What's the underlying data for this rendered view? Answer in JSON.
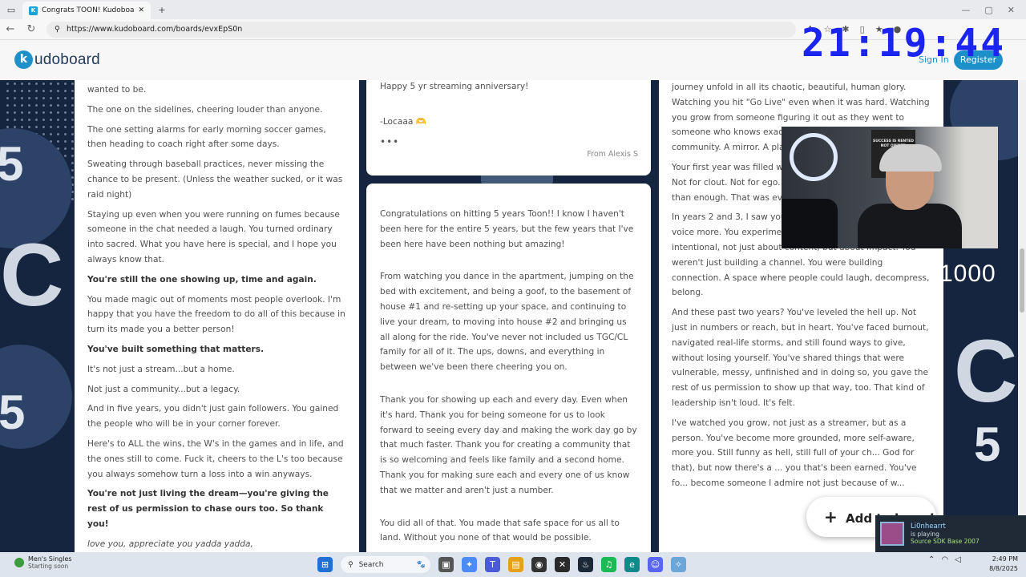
{
  "browser": {
    "tab_title": "Congrats TOON! Kudoboard | Kudoboard",
    "url": "https://www.kudoboard.com/boards/evxEpS0n"
  },
  "site": {
    "logo_letter": "k",
    "logo_text": "udoboard",
    "sign_in": "Sign In",
    "register": "Register"
  },
  "overlay": {
    "clock": "21:19:44",
    "counter": "1000",
    "poster_text": "SUCCESS IS RENTED NOT OWNED"
  },
  "col1": {
    "paragraphs": [
      {
        "text": "wanted to be.",
        "style": "normal"
      },
      {
        "text": "The one on the sidelines, cheering louder than anyone.",
        "style": "normal"
      },
      {
        "text": "The one setting alarms for early morning soccer games, then heading to coach right after some days.",
        "style": "normal"
      },
      {
        "text": "Sweating through baseball practices, never missing the chance to be present. (Unless the weather sucked, or it was raid night)",
        "style": "normal"
      },
      {
        "text": "Staying up even when you were running on fumes because someone in the chat needed a laugh. You turned ordinary into sacred. What you have here is special, and I hope you always know that.",
        "style": "normal"
      },
      {
        "text": "You're still the one showing up, time and again.",
        "style": "bold"
      },
      {
        "text": "You made magic out of moments most people overlook. I'm happy that you have the freedom to do all of this because in turn its made you a better person!",
        "style": "normal"
      },
      {
        "text": "You've built something that matters.",
        "style": "bold"
      },
      {
        "text": "It's not just a stream...but a home.",
        "style": "normal"
      },
      {
        "text": "Not just a community...but a legacy.",
        "style": "normal"
      },
      {
        "text": "And in five years, you didn't just gain followers. You gained the people who will be in your corner forever.",
        "style": "normal"
      },
      {
        "text": "Here's to ALL the wins, the W's in the games and in life, and the ones still to come. Fuck it, cheers to the L's too because you always somehow turn a loss into a win anyways.",
        "style": "normal"
      },
      {
        "text": "You're not just living the dream—you're giving the rest of us permission to chase ours too. So thank you!",
        "style": "bold"
      },
      {
        "text": "love you, appreciate you yadda yadda, blahblahblah...always.",
        "style": "italic"
      }
    ]
  },
  "col2a": {
    "line1": "Happy 5 yr streaming anniversary!",
    "line2": "-Locaaa 🫶",
    "more": "•••",
    "from": "From Alexis S"
  },
  "col2b": {
    "paragraphs": [
      "Congratulations on hitting 5 years Toon!! I know I haven't been here for the entire 5 years, but the few years that I've been here have been nothing but amazing!",
      "From watching you dance in the apartment, jumping on the bed with excitement, and being a goof, to the basement of house #1 and re-setting up your space, and continuing to live your dream, to moving into house #2 and bringing us all along for the ride. You've never not included us TGC/CL family for all of it. The ups, downs, and everything in between we've been there cheering you on.",
      "Thank you for showing up each and every day. Even when it's hard. Thank you for being someone for us to look forward to seeing every day and making the work day go by that much faster. Thank you for creating a community that is so welcoming and feels like family and a second home. Thank you for making sure each and every one of us know that we matter and aren't just a number.",
      "You did all of that. You made that safe space for us all to land. Without you none of that would be possible."
    ]
  },
  "col3": {
    "paragraphs": [
      "journey unfold in all its chaotic, beautiful, human glory. Watching you hit \"Go Live\" even when it was hard. Watching you grow from someone figuring it out as they went to someone who knows exac... The space you've created i... community. A mirror. A pla... matter.",
      "Your first year was filled wi... existential dread, low-view... Not for clout. Not for ego. ... trying to be perfect, you w... than enough. That was everything.",
      "In years 2 and 3, I saw you evolve. You started trusting your voice more. You experimented. You refined. You got intentional, not just about content, but about impact. You weren't just building a channel. You were building connection. A space where people could laugh, decompress, belong.",
      "And these past two years? You've leveled the hell up. Not just in numbers or reach, but in heart. You've faced burnout, navigated real-life storms, and still found ways to give, without losing yourself. You've shared things that were vulnerable, messy, unfinished and in doing so, you gave the rest of us permission to show up that way, too. That kind of leadership isn't loud. It's felt.",
      "I've watched you grow, not just as a streamer, but as a person. You've become more grounded, more self-aware, more you. Still funny as hell, still full of your ch... God for that), but now there's a ... you that's been earned. You've fo... become someone I admire not just because of w..."
    ]
  },
  "fab": {
    "label": "Add to board"
  },
  "toast": {
    "name": "Li0nhearrt",
    "status": "is playing",
    "game": "Source SDK Base 2007"
  },
  "taskbar": {
    "weather_title": "Men's Singles",
    "weather_sub": "Starting soon",
    "search_placeholder": "Search",
    "time": "2:49 PM",
    "date": "8/8/2025"
  }
}
